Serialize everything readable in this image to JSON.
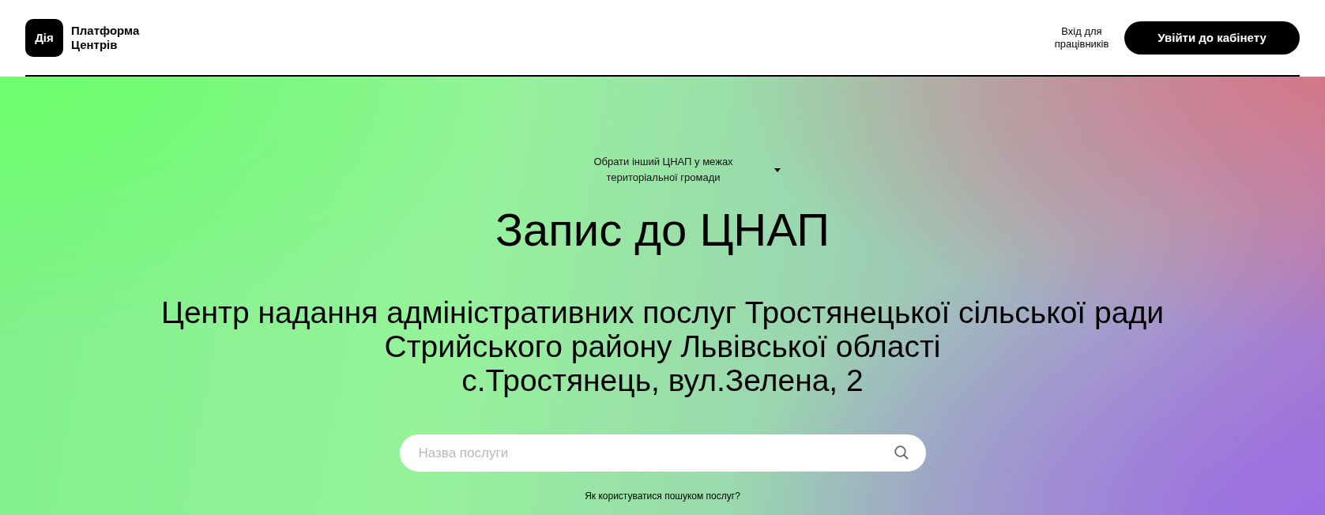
{
  "header": {
    "logo": {
      "mark": "Дія",
      "title_lines": [
        "Платформа",
        "Центрів"
      ]
    },
    "staff_login": "Вхід для працівників",
    "cabinet_button": "Увійти до кабінету"
  },
  "hero": {
    "center_select": "Обрати інший ЦНАП у межах територіальної громади",
    "title": "Запис до ЦНАП",
    "center_name_lines": [
      "Центр надання адміністративних послуг Тростянецької сільської ради",
      "Стрийського району Львівської області",
      "с.Тростянець, вул.Зелена, 2"
    ],
    "search": {
      "placeholder": "Назва послуги"
    },
    "help_link": "Як користуватися пошуком послуг?"
  }
}
